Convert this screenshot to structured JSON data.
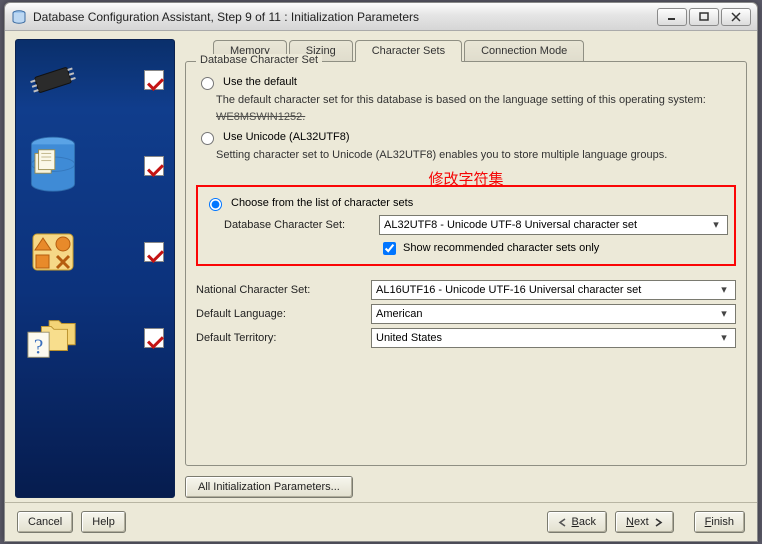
{
  "window": {
    "title": "Database Configuration Assistant, Step 9 of 11 : Initialization Parameters"
  },
  "tabs": {
    "memory": "Memory",
    "sizing": "Sizing",
    "charsets": "Character Sets",
    "connmode": "Connection Mode"
  },
  "fieldset": {
    "legend": "Database Character Set"
  },
  "radios": {
    "use_default": "Use the default",
    "use_default_desc_1": "The default character set for this database is based on the language setting of this operating system: ",
    "use_default_desc_os": "WE8MSWIN1252.",
    "use_unicode": "Use Unicode (AL32UTF8)",
    "use_unicode_desc": "Setting character set to Unicode (AL32UTF8) enables you to store multiple language groups.",
    "choose_list": "Choose from the list of character sets"
  },
  "annotation": "修改字符集",
  "form": {
    "db_charset_label": "Database Character Set:",
    "db_charset_value": "AL32UTF8 - Unicode UTF-8 Universal character set",
    "show_recommended": "Show recommended character sets only",
    "national_label": "National Character Set:",
    "national_value": "AL16UTF16 - Unicode UTF-16 Universal character set",
    "default_lang_label": "Default Language:",
    "default_lang_value": "American",
    "default_terr_label": "Default Territory:",
    "default_terr_value": "United States"
  },
  "buttons": {
    "all_params": "All Initialization Parameters...",
    "cancel": "Cancel",
    "help": "Help",
    "back": "Back",
    "next": "Next",
    "finish": "Finish"
  }
}
